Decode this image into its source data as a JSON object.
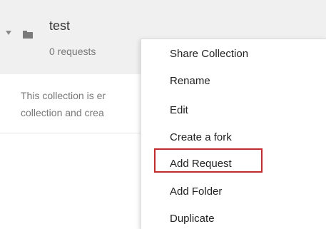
{
  "collection": {
    "name": "test",
    "request_count": "0 requests",
    "empty_message_line1": "This collection is er",
    "empty_message_line2": "collection and crea"
  },
  "context_menu": {
    "items": [
      {
        "label": "Share Collection"
      },
      {
        "label": "Rename"
      },
      {
        "label": "Edit"
      },
      {
        "label": "Create a fork"
      },
      {
        "label": "Add Request",
        "highlighted": true
      },
      {
        "label": "Add Folder"
      },
      {
        "label": "Duplicate"
      }
    ]
  },
  "colors": {
    "header_bg": "#f0f0f0",
    "highlight": "#e02020"
  },
  "icons": [
    "caret-down-icon",
    "folder-icon"
  ]
}
